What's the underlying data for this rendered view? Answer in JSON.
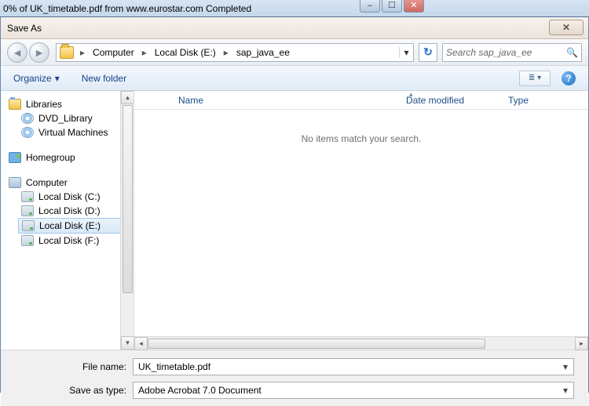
{
  "background_window": {
    "title_fragment": "0% of UK_timetable.pdf from www.eurostar.com Completed"
  },
  "dialog": {
    "title": "Save As",
    "breadcrumb": {
      "segments": [
        "Computer",
        "Local Disk (E:)",
        "sap_java_ee"
      ]
    },
    "search": {
      "placeholder": "Search sap_java_ee"
    },
    "toolbar": {
      "organize": "Organize",
      "newfolder": "New folder"
    },
    "columns": {
      "name": "Name",
      "date": "Date modified",
      "type": "Type"
    },
    "empty_msg": "No items match your search.",
    "tree": {
      "libraries": {
        "label": "Libraries",
        "children": [
          "DVD_Library",
          "Virtual Machines"
        ]
      },
      "homegroup": {
        "label": "Homegroup"
      },
      "computer": {
        "label": "Computer",
        "drives": [
          "Local Disk (C:)",
          "Local Disk (D:)",
          "Local Disk (E:)",
          "Local Disk (F:)"
        ]
      },
      "selected_drive_index": 2
    },
    "fields": {
      "filename_label": "File name:",
      "filename_value": "UK_timetable.pdf",
      "saveas_label": "Save as type:",
      "saveas_value": "Adobe Acrobat 7.0 Document"
    }
  }
}
